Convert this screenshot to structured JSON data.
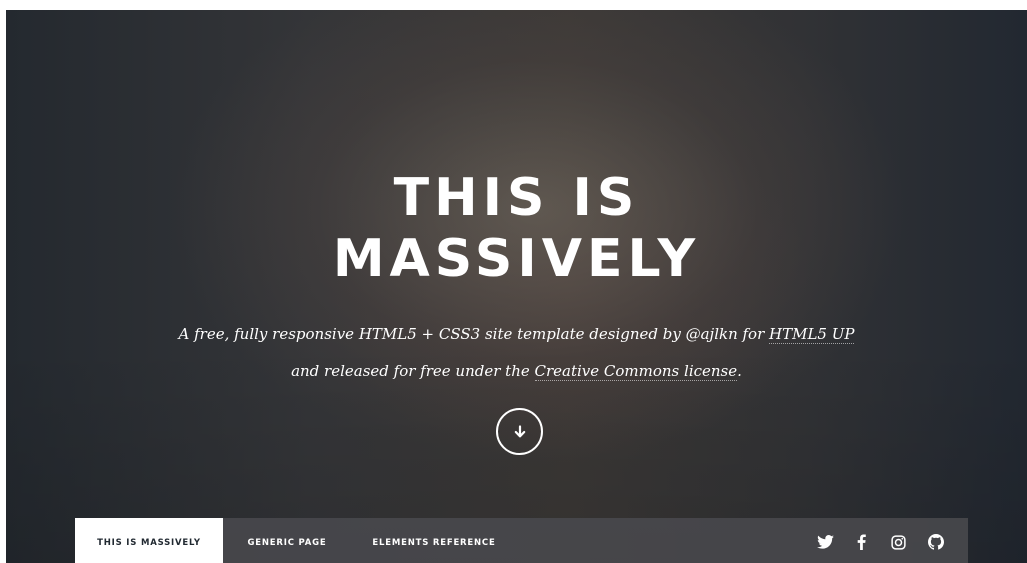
{
  "hero": {
    "title_line1": "THIS IS",
    "title_line2": "MASSIVELY",
    "tagline": {
      "part1": "A free, fully responsive HTML5 + CSS3 site template designed by @ajlkn for ",
      "link1": "HTML5 UP",
      "part2": "and released for free under the ",
      "link2": "Creative Commons license",
      "part3": "."
    }
  },
  "scroll_button": {
    "icon": "arrow-down-icon"
  },
  "nav": {
    "items": [
      {
        "label": "THIS IS MASSIVELY",
        "active": true
      },
      {
        "label": "GENERIC PAGE",
        "active": false
      },
      {
        "label": "ELEMENTS REFERENCE",
        "active": false
      }
    ],
    "social": [
      {
        "icon": "twitter-icon"
      },
      {
        "icon": "facebook-icon"
      },
      {
        "icon": "instagram-icon"
      },
      {
        "icon": "github-icon"
      }
    ]
  }
}
